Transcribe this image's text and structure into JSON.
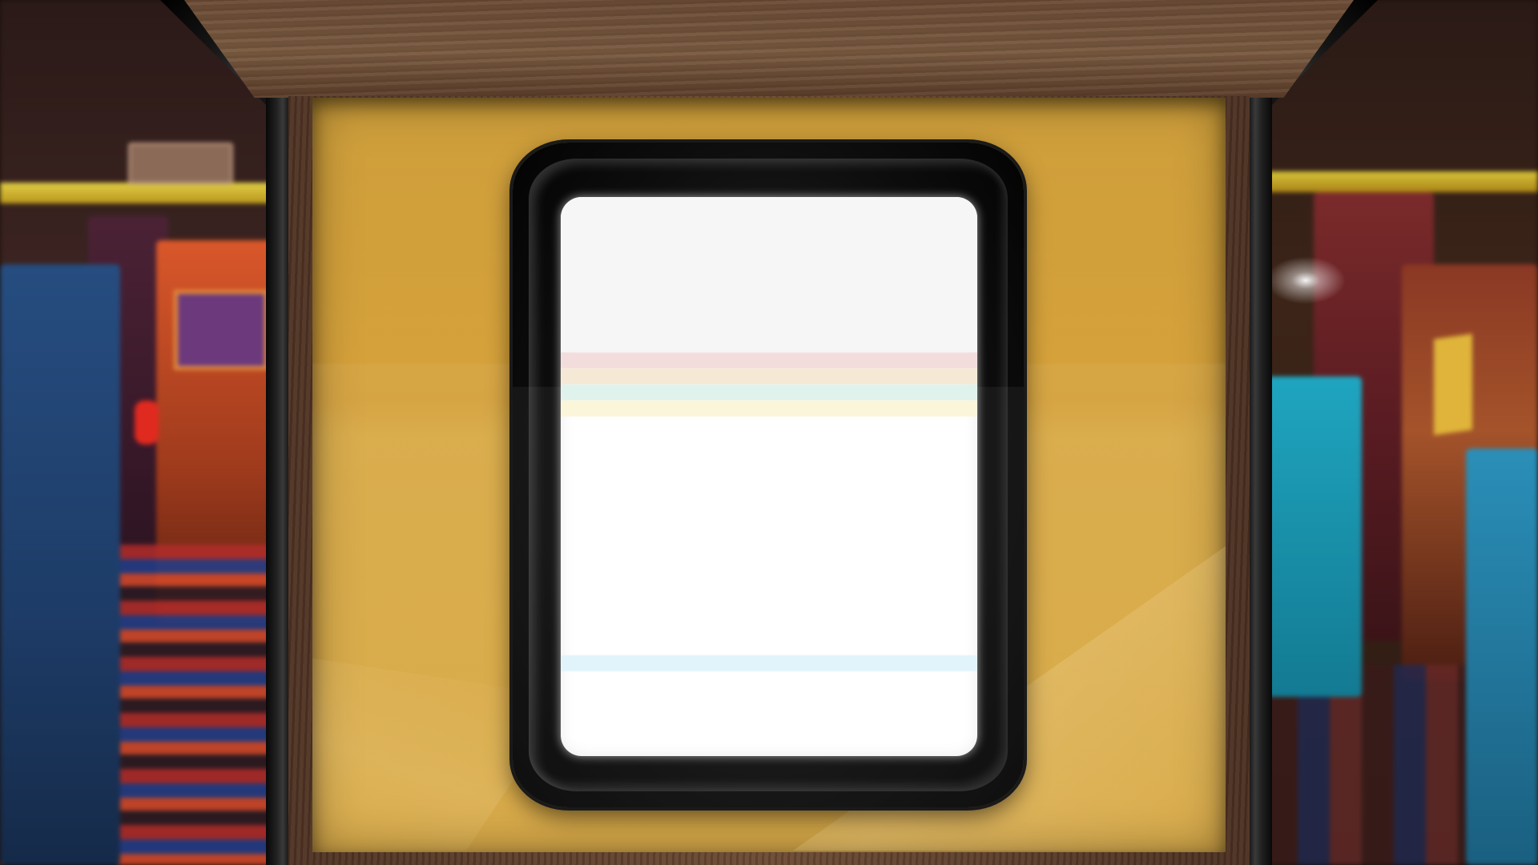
{
  "scene": "arcade-cabinet",
  "screen": {
    "background": "#ffffff",
    "top_zone_color": "#f6f6f6",
    "bands": [
      {
        "color": "#f3dcdc"
      },
      {
        "color": "#f5e9d6"
      },
      {
        "color": "#dff2ec"
      },
      {
        "color": "#fbf5d9"
      },
      {
        "color": "#e2f4fb"
      }
    ]
  },
  "colors": {
    "bezel": "#d9a73e",
    "wood": "#6b4c36",
    "crt_housing": "#0d0d0d"
  }
}
